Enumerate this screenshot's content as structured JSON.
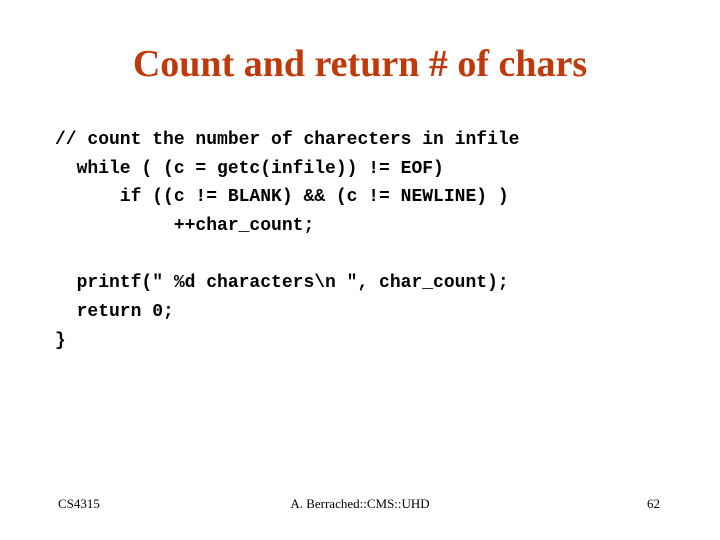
{
  "slide": {
    "title": "Count and return # of chars",
    "title_color": "#c0390b",
    "code_lines": [
      "// count the number of charecters in infile",
      "  while ( (c = getc(infile)) != EOF)",
      "      if ((c != BLANK) && (c != NEWLINE) )",
      "           ++char_count;",
      "",
      "  printf(\" %d characters\\n \", char_count);",
      "  return 0;",
      "}"
    ],
    "footer": {
      "course": "CS4315",
      "author": "A. Berrached::CMS::UHD",
      "page_number": "62"
    }
  }
}
